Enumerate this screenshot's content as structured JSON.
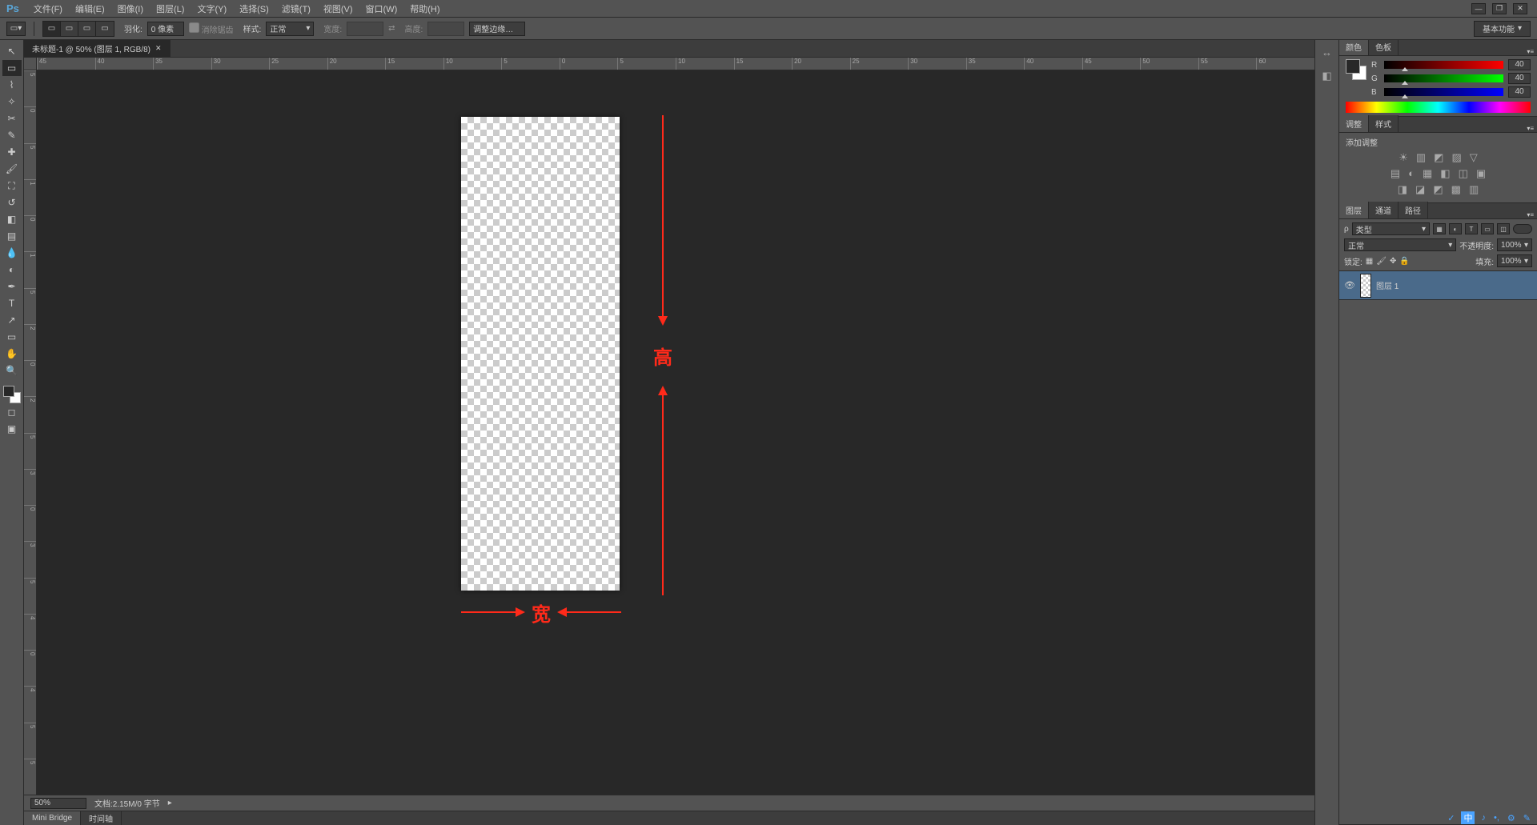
{
  "menu": {
    "items": [
      "文件(F)",
      "编辑(E)",
      "图像(I)",
      "图层(L)",
      "文字(Y)",
      "选择(S)",
      "滤镜(T)",
      "视图(V)",
      "窗口(W)",
      "帮助(H)"
    ]
  },
  "options": {
    "feather_label": "羽化:",
    "feather_value": "0 像素",
    "antialias": "消除锯齿",
    "style_label": "样式:",
    "style_value": "正常",
    "width_label": "宽度:",
    "height_label": "高度:",
    "refine": "调整边缘…",
    "workspace": "基本功能"
  },
  "doc_tab": {
    "title": "未标题-1 @ 50% (图层 1, RGB/8)"
  },
  "ruler_h": [
    "45",
    "40",
    "35",
    "30",
    "25",
    "20",
    "15",
    "10",
    "5",
    "0",
    "5",
    "10",
    "15",
    "20",
    "25",
    "30",
    "35",
    "40",
    "45",
    "50",
    "55",
    "60"
  ],
  "ruler_v": [
    "5",
    "0",
    "5",
    "1",
    "0",
    "1",
    "5",
    "2",
    "0",
    "2",
    "5",
    "3",
    "0",
    "3",
    "5",
    "4",
    "0",
    "4",
    "5",
    "5"
  ],
  "status": {
    "zoom": "50%",
    "doc_label": "文档:",
    "doc_info": "2.15M/0 字节"
  },
  "bottom_tabs": {
    "bridge": "Mini Bridge",
    "timeline": "时间轴"
  },
  "annotations": {
    "height": "高",
    "width": "宽"
  },
  "panel_color": {
    "tab_color": "颜色",
    "tab_swatches": "色板",
    "rows": [
      {
        "ch": "R",
        "val": "40"
      },
      {
        "ch": "G",
        "val": "40"
      },
      {
        "ch": "B",
        "val": "40"
      }
    ]
  },
  "panel_adjust": {
    "tab_adjust": "调整",
    "tab_styles": "样式",
    "title": "添加调整"
  },
  "panel_layers": {
    "tab_layers": "图层",
    "tab_channels": "通道",
    "tab_paths": "路径",
    "kind": "类型",
    "blend": "正常",
    "opacity_label": "不透明度:",
    "opacity": "100%",
    "lock_label": "锁定:",
    "fill_label": "填充:",
    "fill": "100%",
    "layer1": "图层 1"
  },
  "ime": {
    "items": [
      "中",
      "♪",
      "•,",
      "⚙",
      "✎"
    ]
  }
}
